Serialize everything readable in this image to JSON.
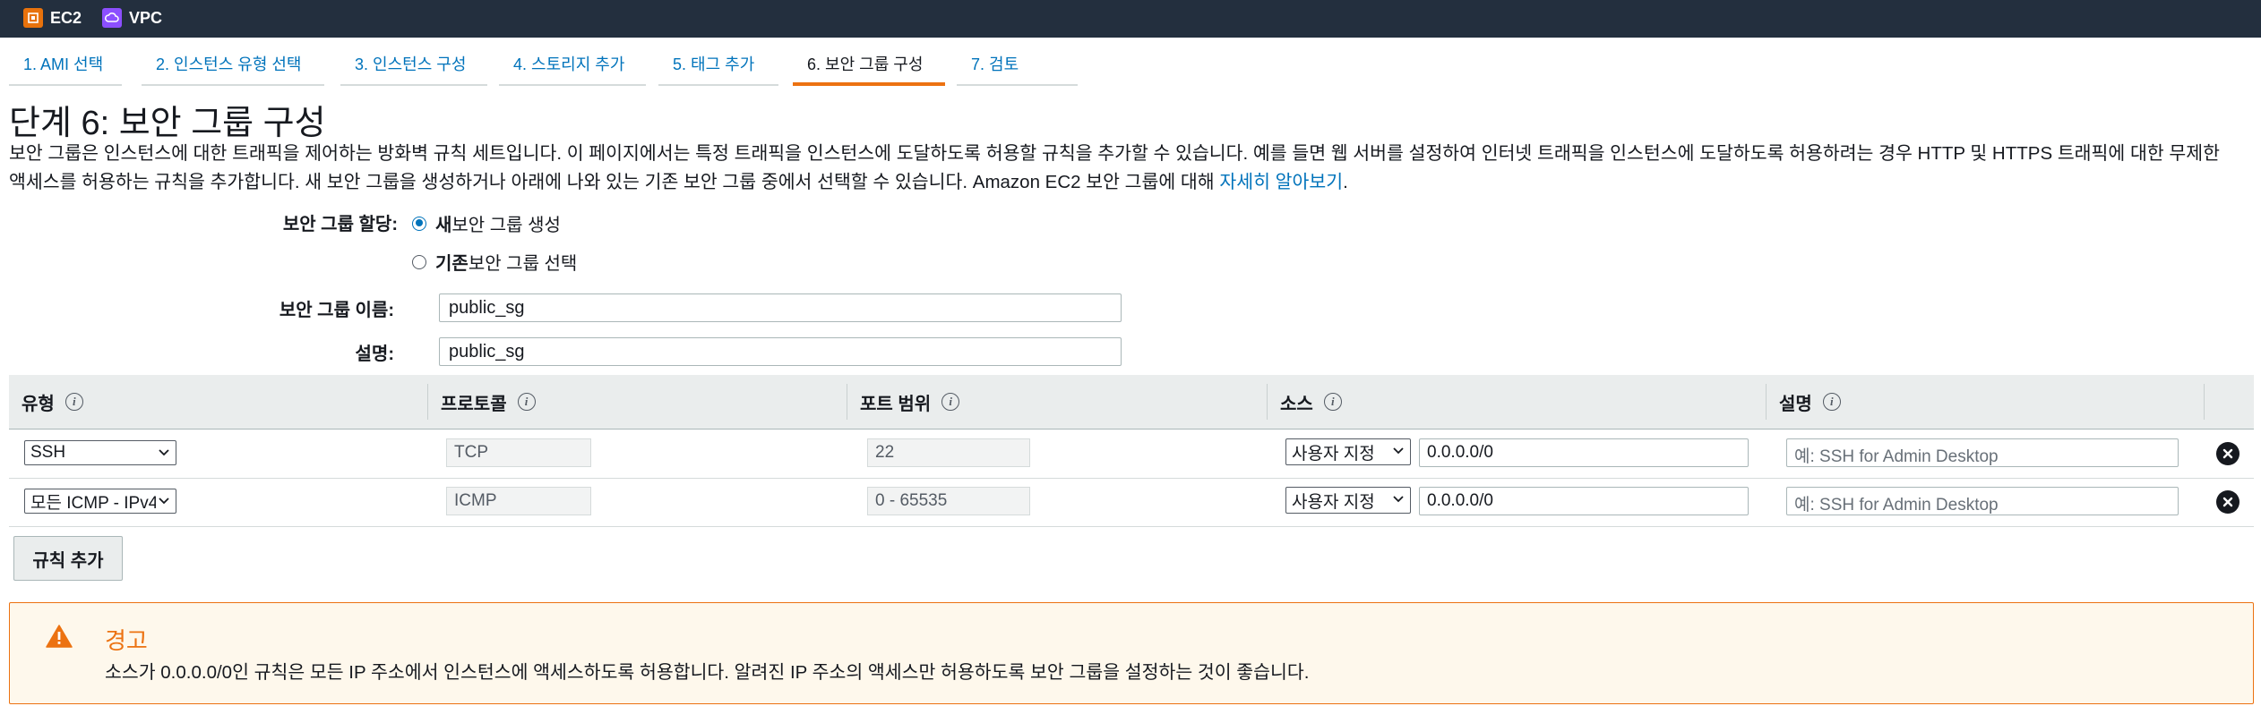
{
  "nav": {
    "services": [
      {
        "label": "EC2",
        "icon": "ec2-icon"
      },
      {
        "label": "VPC",
        "icon": "vpc-icon"
      }
    ]
  },
  "tabs": [
    {
      "label": "1. AMI 선택",
      "active": false
    },
    {
      "label": "2. 인스턴스 유형 선택",
      "active": false
    },
    {
      "label": "3. 인스턴스 구성",
      "active": false
    },
    {
      "label": "4. 스토리지 추가",
      "active": false
    },
    {
      "label": "5. 태그 추가",
      "active": false
    },
    {
      "label": "6. 보안 그룹 구성",
      "active": true
    },
    {
      "label": "7. 검토",
      "active": false
    }
  ],
  "page": {
    "title": "단계 6: 보안 그룹 구성",
    "intro": "보안 그룹은 인스턴스에 대한 트래픽을 제어하는 방화벽 규칙 세트입니다. 이 페이지에서는 특정 트래픽을 인스턴스에 도달하도록 허용할 규칙을 추가할 수 있습니다. 예를 들면 웹 서버를 설정하여 인터넷 트래픽을 인스턴스에 도달하도록 허용하려는 경우 HTTP 및 HTTPS 트래픽에 대한 무제한 액세스를 허용하는 규칙을 추가합니다. 새 보안 그룹을 생성하거나 아래에 나와 있는 기존 보안 그룹 중에서 선택할 수 있습니다. Amazon EC2 보안 그룹에 대해 ",
    "learn_more": "자세히 알아보기",
    "intro_end": "."
  },
  "form": {
    "assign_label": "보안 그룹 할당:",
    "option_new_bold": "새",
    "option_new_rest": " 보안 그룹 생성",
    "option_existing_bold": "기존",
    "option_existing_rest": " 보안 그룹 선택",
    "selected_option": "new",
    "name_label": "보안 그룹 이름:",
    "name_value": "public_sg",
    "desc_label": "설명:",
    "desc_value": "public_sg"
  },
  "table": {
    "headers": [
      "유형",
      "프로토콜",
      "포트 범위",
      "소스",
      "설명"
    ],
    "rows": [
      {
        "type": "SSH",
        "protocol": "TCP",
        "port": "22",
        "source_type": "사용자 지정",
        "source": "0.0.0.0/0",
        "description_placeholder": "예: SSH for Admin Desktop"
      },
      {
        "type": "모든 ICMP - IPv4",
        "protocol": "ICMP",
        "port": "0 - 65535",
        "source_type": "사용자 지정",
        "source": "0.0.0.0/0",
        "description_placeholder": "예: SSH for Admin Desktop"
      }
    ],
    "add_rule_label": "규칙 추가"
  },
  "warning": {
    "title": "경고",
    "text": "소스가 0.0.0.0/0인 규칙은 모든 IP 주소에서 인스턴스에 액세스하도록 허용합니다. 알려진 IP 주소의 액세스만 허용하도록 보안 그룹을 설정하는 것이 좋습니다."
  },
  "colors": {
    "nav_bg": "#232f3e",
    "link": "#0073bb",
    "accent": "#ec7211",
    "warning_bg": "#fef8ec"
  }
}
